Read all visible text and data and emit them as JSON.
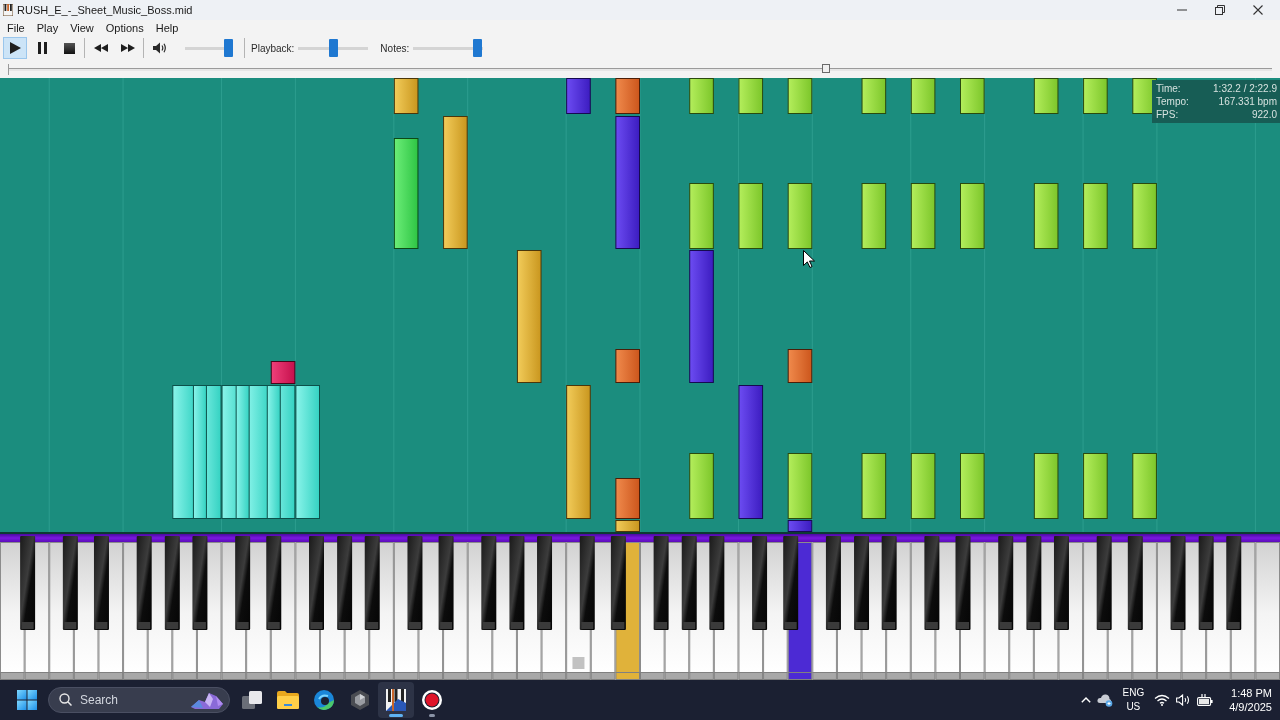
{
  "window": {
    "title": "RUSH_E_-_Sheet_Music_Boss.mid"
  },
  "menu": [
    {
      "label": "File"
    },
    {
      "label": "Play"
    },
    {
      "label": "View"
    },
    {
      "label": "Options"
    },
    {
      "label": "Help"
    }
  ],
  "toolbar": {
    "transport": [
      {
        "kind": "play",
        "pressed": true
      },
      {
        "kind": "pause",
        "pressed": false
      },
      {
        "kind": "stop",
        "pressed": false
      }
    ],
    "skip": [
      {
        "kind": "rewind",
        "pressed": false
      },
      {
        "kind": "forward",
        "pressed": false
      }
    ],
    "volume": {
      "level": 1
    },
    "sliders": [
      {
        "label": "Playback:",
        "level": 0.5
      },
      {
        "label": "Notes:",
        "level": 0.98
      }
    ]
  },
  "seek": {
    "level": 0.648
  },
  "stats": [
    {
      "label": "Time:",
      "value": "1:32.2 / 2:22.9"
    },
    {
      "label": "Tempo:",
      "value": "167.331 bpm"
    },
    {
      "label": "FPS:",
      "value": "922.0"
    }
  ],
  "keyboard": {
    "white_keys": [
      {
        "pressed": false
      },
      {
        "pressed": false
      },
      {
        "pressed": false
      },
      {
        "pressed": false
      },
      {
        "pressed": false
      },
      {
        "pressed": false
      },
      {
        "pressed": false
      },
      {
        "pressed": false
      },
      {
        "pressed": false
      },
      {
        "pressed": false
      },
      {
        "pressed": false
      },
      {
        "pressed": false
      },
      {
        "pressed": false
      },
      {
        "pressed": false
      },
      {
        "pressed": false
      },
      {
        "pressed": false
      },
      {
        "pressed": false
      },
      {
        "pressed": false
      },
      {
        "pressed": false
      },
      {
        "pressed": false
      },
      {
        "pressed": false
      },
      {
        "pressed": false
      },
      {
        "pressed": false
      },
      {
        "pressed": false
      },
      {
        "pressed": false
      },
      {
        "pressed": true,
        "color": "#e0b23a"
      },
      {
        "pressed": false
      },
      {
        "pressed": false
      },
      {
        "pressed": false
      },
      {
        "pressed": false
      },
      {
        "pressed": false
      },
      {
        "pressed": false
      },
      {
        "pressed": true,
        "color": "#4c2ad4"
      },
      {
        "pressed": false
      },
      {
        "pressed": false
      },
      {
        "pressed": false
      },
      {
        "pressed": false
      },
      {
        "pressed": false
      },
      {
        "pressed": false
      },
      {
        "pressed": false
      },
      {
        "pressed": false
      },
      {
        "pressed": false
      },
      {
        "pressed": false
      },
      {
        "pressed": false
      },
      {
        "pressed": false
      },
      {
        "pressed": false
      },
      {
        "pressed": false
      },
      {
        "pressed": false
      },
      {
        "pressed": false
      },
      {
        "pressed": false
      },
      {
        "pressed": false
      },
      {
        "pressed": false
      }
    ]
  },
  "taskbar": {
    "search": {
      "placeholder": "Search"
    },
    "apps": [
      {
        "kind": "task-view",
        "running": false,
        "selected": false
      },
      {
        "kind": "folder",
        "running": false,
        "selected": false
      },
      {
        "kind": "browser",
        "running": false,
        "selected": false
      },
      {
        "kind": "hexagon",
        "running": false,
        "selected": false
      },
      {
        "kind": "piano",
        "running": true,
        "selected": true
      },
      {
        "kind": "record",
        "running": true,
        "selected": false
      }
    ]
  },
  "tray": {
    "language": "ENG",
    "region": "US",
    "time": "1:48 PM",
    "date": "4/9/2025"
  }
}
